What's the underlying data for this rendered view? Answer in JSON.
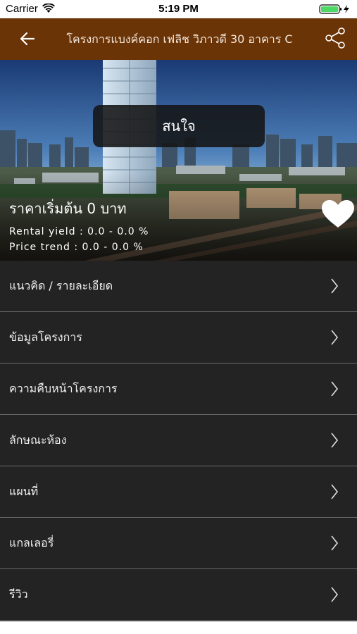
{
  "status_bar": {
    "carrier": "Carrier",
    "time": "5:19 PM",
    "battery_color": "#4cd964"
  },
  "nav": {
    "title": "โครงการแบงค์คอก เฟลิช วิภาวดี 30 อาคาร C",
    "back_icon": "back-arrow-icon",
    "share_icon": "share-icon",
    "background": "#6b3407"
  },
  "hero": {
    "interest_label": "สนใจ",
    "price_label": "ราคาเริ่มต้น 0 บาท",
    "rental_yield": "Rental yield : 0.0 - 0.0 %",
    "price_trend": "Price trend : 0.0 - 0.0 %",
    "favorite_icon": "heart-icon"
  },
  "menu": {
    "items": [
      {
        "label": "แนวคิด / รายละเอียด"
      },
      {
        "label": "ข้อมูลโครงการ"
      },
      {
        "label": "ความคืบหน้าโครงการ"
      },
      {
        "label": "ลักษณะห้อง"
      },
      {
        "label": "แผนที่"
      },
      {
        "label": "แกลเลอรี่"
      },
      {
        "label": "รีวิว"
      }
    ]
  }
}
